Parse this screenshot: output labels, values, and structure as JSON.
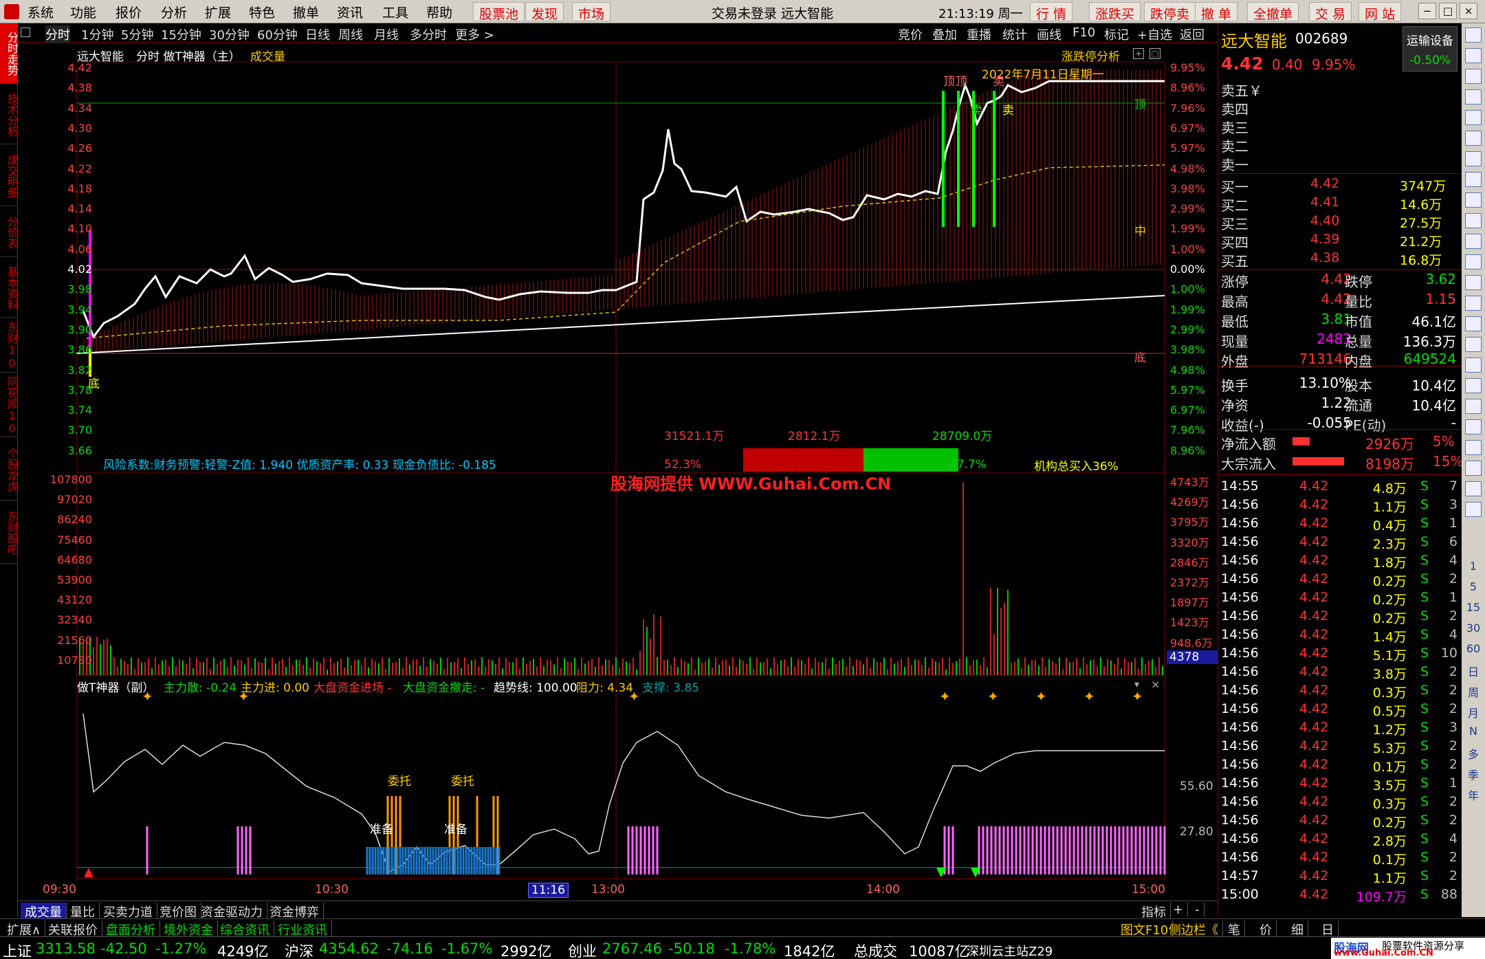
{
  "window": {
    "title": "交易未登录  远大智能",
    "clock": "21:13:19 周一"
  },
  "menu": {
    "items": [
      "系统",
      "功能",
      "报价",
      "分析",
      "扩展",
      "特色",
      "撤单",
      "资讯",
      "工具",
      "帮助"
    ],
    "red_items": [
      "股票池",
      "发现",
      "市场"
    ],
    "right_items": [
      "行 情",
      "涨跌买",
      "跌停卖",
      "撤 单",
      "全撤单",
      "交 易",
      "网 站"
    ]
  },
  "left_tabs": [
    "分时走势",
    "技术分析",
    "成交明细",
    "分价表",
    "基本资料",
    "东财10",
    "同花顺10",
    "个股龙虎",
    "东财股吧"
  ],
  "periods": [
    "分时",
    "1分钟",
    "5分钟",
    "15分钟",
    "30分钟",
    "60分钟",
    "日线",
    "周线",
    "月线",
    "多分时",
    "更多 >"
  ],
  "period_right": [
    "竞价",
    "叠加",
    "重播",
    "统计",
    "画线",
    "F10",
    "标记",
    "+自选",
    "返回"
  ],
  "chart": {
    "header_name": "远大智能",
    "header_mode": "分时 做T神器（主）",
    "header_volume": "成交量",
    "limit_analysis": "涨跌停分析",
    "date_label": "2022年7月11日星期一",
    "price_axis": [
      "4.42",
      "4.38",
      "4.34",
      "4.30",
      "4.26",
      "4.22",
      "4.18",
      "4.14",
      "4.10",
      "4.06",
      "4.02",
      "3.98",
      "3.94",
      "3.90",
      "3.86",
      "3.82",
      "3.78",
      "3.74",
      "3.70",
      "3.66"
    ],
    "pct_axis": [
      "9.95%",
      "8.96%",
      "7.96%",
      "6.97%",
      "5.97%",
      "4.98%",
      "3.98%",
      "2.99%",
      "1.99%",
      "1.00%",
      "0.00%",
      "1.00%",
      "1.99%",
      "2.99%",
      "3.98%",
      "4.98%",
      "5.97%",
      "6.97%",
      "7.96%",
      "8.96%"
    ],
    "markers": {
      "top": "顶",
      "top2": "顶",
      "mid": "中",
      "bottom": "底",
      "bottom_left": "底",
      "sell1": "卖",
      "sell2": "卖",
      "sell3": "卖"
    },
    "risk_line": "风险系数:财务预警:轻警-Z值: 1.940 优质资产率: 0.33 现金负债比: -0.185",
    "flow_left_amt": "31521.1万",
    "flow_mid_amt": "2812.1万",
    "flow_right_amt": "28709.0万",
    "flow_left_pct": "52.3%",
    "flow_right_pct": "47.7%",
    "inst_buy": "机构总买入36%",
    "watermark": "股海网提供 WWW.Guhai.Com.CN",
    "vol_axis": [
      "107800",
      "97020",
      "86240",
      "75460",
      "64680",
      "53900",
      "43120",
      "32340",
      "21560",
      "10780"
    ],
    "amt_axis": [
      "4743万",
      "4269万",
      "3795万",
      "3320万",
      "2846万",
      "2372万",
      "1897万",
      "1423万",
      "948.6万"
    ],
    "vol_current": "4378",
    "sub_title": "做T神器（副）",
    "sub_main_scatter": "主力散: -0.24",
    "sub_main_in": "主力进: 0.00",
    "sub_big_in": "大盘资金进场 -",
    "sub_big_out": "大盘资金撤走: -",
    "sub_trend": "趋势线: 100.00",
    "sub_resist": "阻力: 4.34",
    "sub_support": "支撑: 3.85",
    "sub_axis1": "55.60",
    "sub_axis2": "27.80",
    "sub_labels": {
      "wt1": "委托",
      "wt2": "委托",
      "zb1": "准备",
      "zb2": "准备"
    },
    "time_axis": [
      "09:30",
      "10:30",
      "11:16",
      "13:00",
      "14:00",
      "15:00"
    ]
  },
  "quote": {
    "name": "远大智能",
    "code": "002689",
    "btn": "运输设备",
    "btn_pct": "-0.50%",
    "price": "4.42",
    "change": "0.40",
    "change_pct": "9.95%",
    "sells": [
      "卖五￥",
      "卖四",
      "卖三",
      "卖二",
      "卖一"
    ],
    "buys": [
      {
        "label": "买一",
        "price": "4.42",
        "vol": "3747万"
      },
      {
        "label": "买二",
        "price": "4.41",
        "vol": "14.6万"
      },
      {
        "label": "买三",
        "price": "4.40",
        "vol": "27.5万"
      },
      {
        "label": "买四",
        "price": "4.39",
        "vol": "21.2万"
      },
      {
        "label": "买五",
        "price": "4.38",
        "vol": "16.8万"
      }
    ],
    "stats": [
      {
        "l1": "涨停",
        "v1": "4.42",
        "l2": "跌停",
        "v2": "3.62",
        "c1": "red",
        "c2": "green"
      },
      {
        "l1": "最高",
        "v1": "4.42",
        "l2": "量比",
        "v2": "1.15",
        "c1": "red",
        "c2": "red"
      },
      {
        "l1": "最低",
        "v1": "3.81",
        "l2": "市值",
        "v2": "46.1亿",
        "c1": "green",
        "c2": "white"
      },
      {
        "l1": "现量",
        "v1": "2483",
        "l2": "总量",
        "v2": "136.3万",
        "c1": "magenta",
        "c2": "white"
      },
      {
        "l1": "外盘",
        "v1": "713146",
        "l2": "内盘",
        "v2": "649524",
        "c1": "red",
        "c2": "green"
      },
      {
        "l1": "换手",
        "v1": "13.10%",
        "l2": "股本",
        "v2": "10.4亿",
        "c1": "white",
        "c2": "white"
      },
      {
        "l1": "净资",
        "v1": "1.22",
        "l2": "流通",
        "v2": "10.4亿",
        "c1": "white",
        "c2": "white"
      },
      {
        "l1": "收益(-)",
        "v1": "-0.055",
        "l2": "PE(动)",
        "v2": "-",
        "c1": "white",
        "c2": "white"
      }
    ],
    "flows": [
      {
        "label": "净流入额",
        "amt": "2926万",
        "pct": "5%",
        "bar": 0.05
      },
      {
        "label": "大宗流入",
        "amt": "8198万",
        "pct": "15%",
        "bar": 0.15
      }
    ],
    "ticks": [
      [
        "14:55",
        "4.42",
        "4.8万",
        "S",
        "7"
      ],
      [
        "14:56",
        "4.42",
        "1.1万",
        "S",
        "3"
      ],
      [
        "14:56",
        "4.42",
        "0.4万",
        "S",
        "1"
      ],
      [
        "14:56",
        "4.42",
        "2.3万",
        "S",
        "6"
      ],
      [
        "14:56",
        "4.42",
        "1.8万",
        "S",
        "4"
      ],
      [
        "14:56",
        "4.42",
        "0.2万",
        "S",
        "2"
      ],
      [
        "14:56",
        "4.42",
        "0.2万",
        "S",
        "1"
      ],
      [
        "14:56",
        "4.42",
        "0.2万",
        "S",
        "2"
      ],
      [
        "14:56",
        "4.42",
        "1.4万",
        "S",
        "4"
      ],
      [
        "14:56",
        "4.42",
        "5.1万",
        "S",
        "10"
      ],
      [
        "14:56",
        "4.42",
        "3.8万",
        "S",
        "2"
      ],
      [
        "14:56",
        "4.42",
        "0.3万",
        "S",
        "2"
      ],
      [
        "14:56",
        "4.42",
        "0.5万",
        "S",
        "2"
      ],
      [
        "14:56",
        "4.42",
        "1.2万",
        "S",
        "3"
      ],
      [
        "14:56",
        "4.42",
        "5.3万",
        "S",
        "2"
      ],
      [
        "14:56",
        "4.42",
        "0.1万",
        "S",
        "2"
      ],
      [
        "14:56",
        "4.42",
        "3.5万",
        "S",
        "1"
      ],
      [
        "14:56",
        "4.42",
        "0.3万",
        "S",
        "2"
      ],
      [
        "14:56",
        "4.42",
        "0.2万",
        "S",
        "2"
      ],
      [
        "14:56",
        "4.42",
        "2.8万",
        "S",
        "4"
      ],
      [
        "14:56",
        "4.42",
        "0.1万",
        "S",
        "2"
      ],
      [
        "14:57",
        "4.42",
        "1.1万",
        "S",
        "2"
      ],
      [
        "15:00",
        "4.42",
        "109.7万",
        "S",
        "88"
      ]
    ]
  },
  "bottom_tabs": [
    "成交量",
    "量比",
    "买卖力道",
    "竞价图",
    "资金驱动力",
    "资金博弈",
    "指标",
    "+",
    "-"
  ],
  "bottom_tabs2": [
    "扩展∧",
    "关联报价",
    "盘面分析",
    "境外资金",
    "综合资讯",
    "行业资讯",
    "图文F10",
    "侧边栏《",
    "笔",
    "价",
    "细",
    "日"
  ],
  "tools_text": [
    "1",
    "5",
    "15",
    "30",
    "60",
    "日",
    "周",
    "月",
    "N",
    "多",
    "季",
    "年"
  ],
  "status": {
    "sh_label": "上证",
    "sh_val": "3313.58",
    "sh_chg": "-42.50",
    "sh_pct": "-1.27%",
    "sh_amt": "4249亿",
    "hs_label": "沪深",
    "hs_val": "4354.62",
    "hs_chg": "-74.16",
    "hs_pct": "-1.67%",
    "hs_amt": "2992亿",
    "cy_label": "创业",
    "cy_val": "2767.46",
    "cy_chg": "-50.18",
    "cy_pct": "-1.78%",
    "cy_amt": "1842亿",
    "total_label": "总成交",
    "total_val": "10087亿",
    "server": "深圳云主站Z29",
    "brand": "股海网",
    "brand_sub": "股票软件资源分享",
    "brand_url": "www.Guhai.Com.CN"
  }
}
